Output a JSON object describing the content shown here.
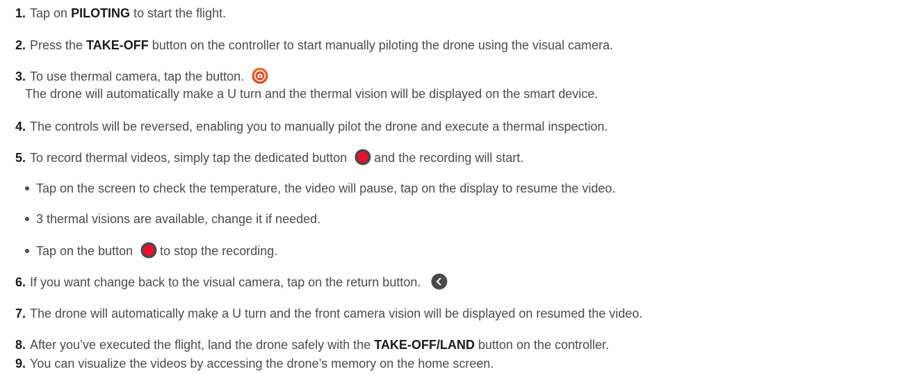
{
  "steps": [
    {
      "num": "1.",
      "pre": "Tap on ",
      "bold": "PILOTING",
      "post": " to start the flight."
    },
    {
      "num": "2.",
      "pre": "Press the ",
      "bold": "TAKE-OFF",
      "post": " button on the controller to start manually piloting the drone using the visual camera."
    },
    {
      "num": "3.",
      "text": "To use thermal camera, tap the button.",
      "cont": "The drone will automatically make a U turn and the thermal vision will be displayed on the smart device."
    },
    {
      "num": "4.",
      "text": "The controls will be reversed, enabling you to manually pilot the drone and execute a thermal inspection."
    },
    {
      "num": "5.",
      "pre": "To record thermal videos, simply tap the dedicated button",
      "post": "and the recording will start."
    },
    {
      "num": "6.",
      "text": "If you want change back to the visual camera, tap on the return button."
    },
    {
      "num": "7.",
      "text": "The drone will automatically make a U turn and the front camera vision will be displayed on resumed the video."
    },
    {
      "num": "8.",
      "pre": "After you’ve executed the flight, land the drone safely with the ",
      "bold": "TAKE-OFF/LAND",
      "post": " button on the controller."
    },
    {
      "num": "9.",
      "text": "You can visualize the videos by accessing the drone’s memory on the home screen."
    }
  ],
  "sub_bullets": [
    {
      "text": "Tap on the screen to check the temperature, the video will pause, tap on the display to resume the video."
    },
    {
      "text": "3 thermal visions are available, change it if needed."
    },
    {
      "pre": "Tap on the button",
      "post": "to stop the recording."
    }
  ],
  "icons": {
    "thermal": "thermal-camera-icon",
    "record": "record-icon",
    "return": "return-icon"
  },
  "colors": {
    "text": "#4b4b4b",
    "record_red": "#e8102c",
    "return_gray": "#4a4a4a"
  }
}
